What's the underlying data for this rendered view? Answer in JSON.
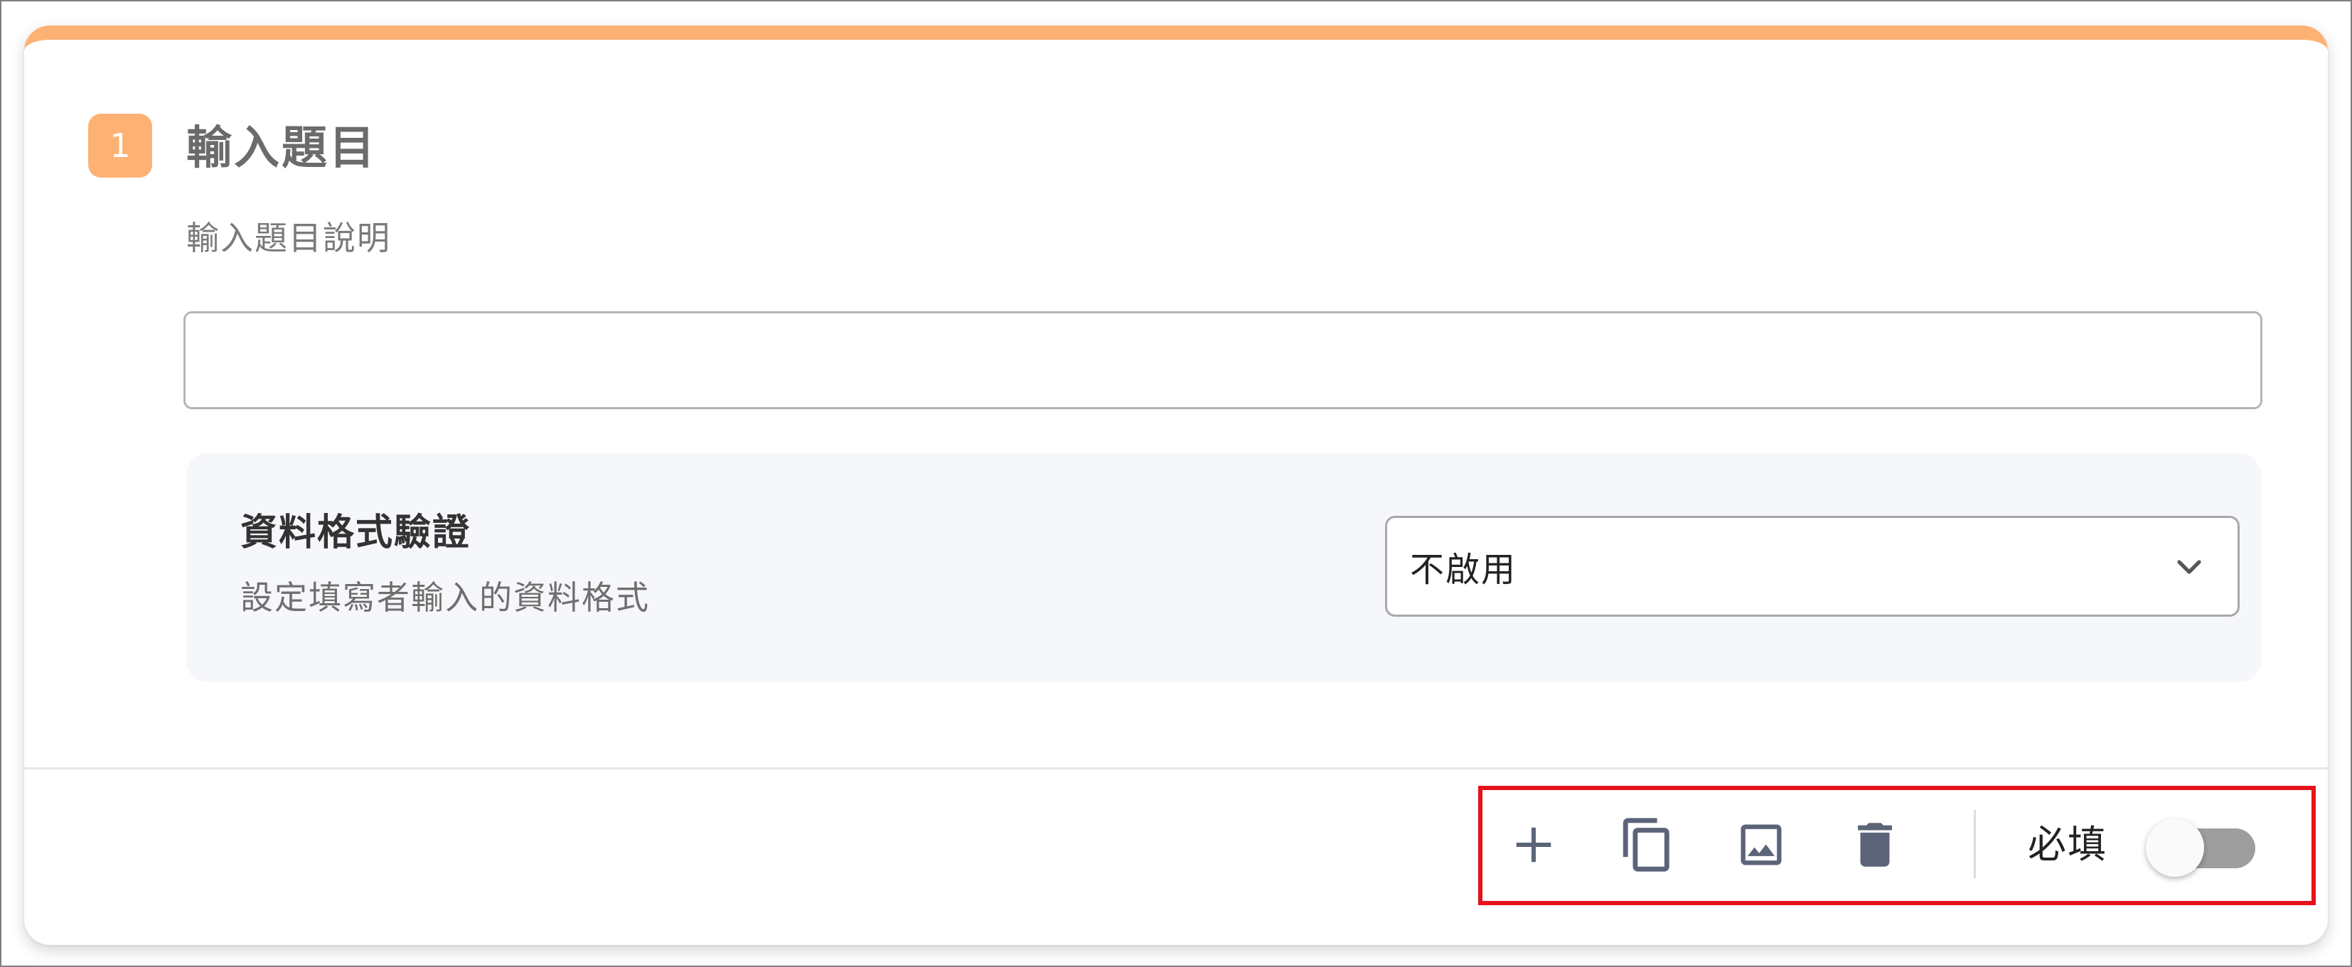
{
  "question": {
    "number": "1",
    "title": "輸入題目",
    "description": "輸入題目說明",
    "answer_value": "",
    "answer_placeholder": ""
  },
  "validation": {
    "title": "資料格式驗證",
    "description": "設定填寫者輸入的資料格式",
    "selected_option": "不啟用"
  },
  "toolbar": {
    "icons": {
      "add": "plus-icon",
      "copy": "copy-icon",
      "image": "image-icon",
      "delete": "trash-icon"
    },
    "required_label": "必填",
    "required_enabled": false
  },
  "colors": {
    "accent": "#fdb274",
    "icon": "#5b6478",
    "highlight_border": "#e5121b",
    "panel_bg": "#f6f7fb",
    "toggle_track_off": "#9e9e9e"
  }
}
